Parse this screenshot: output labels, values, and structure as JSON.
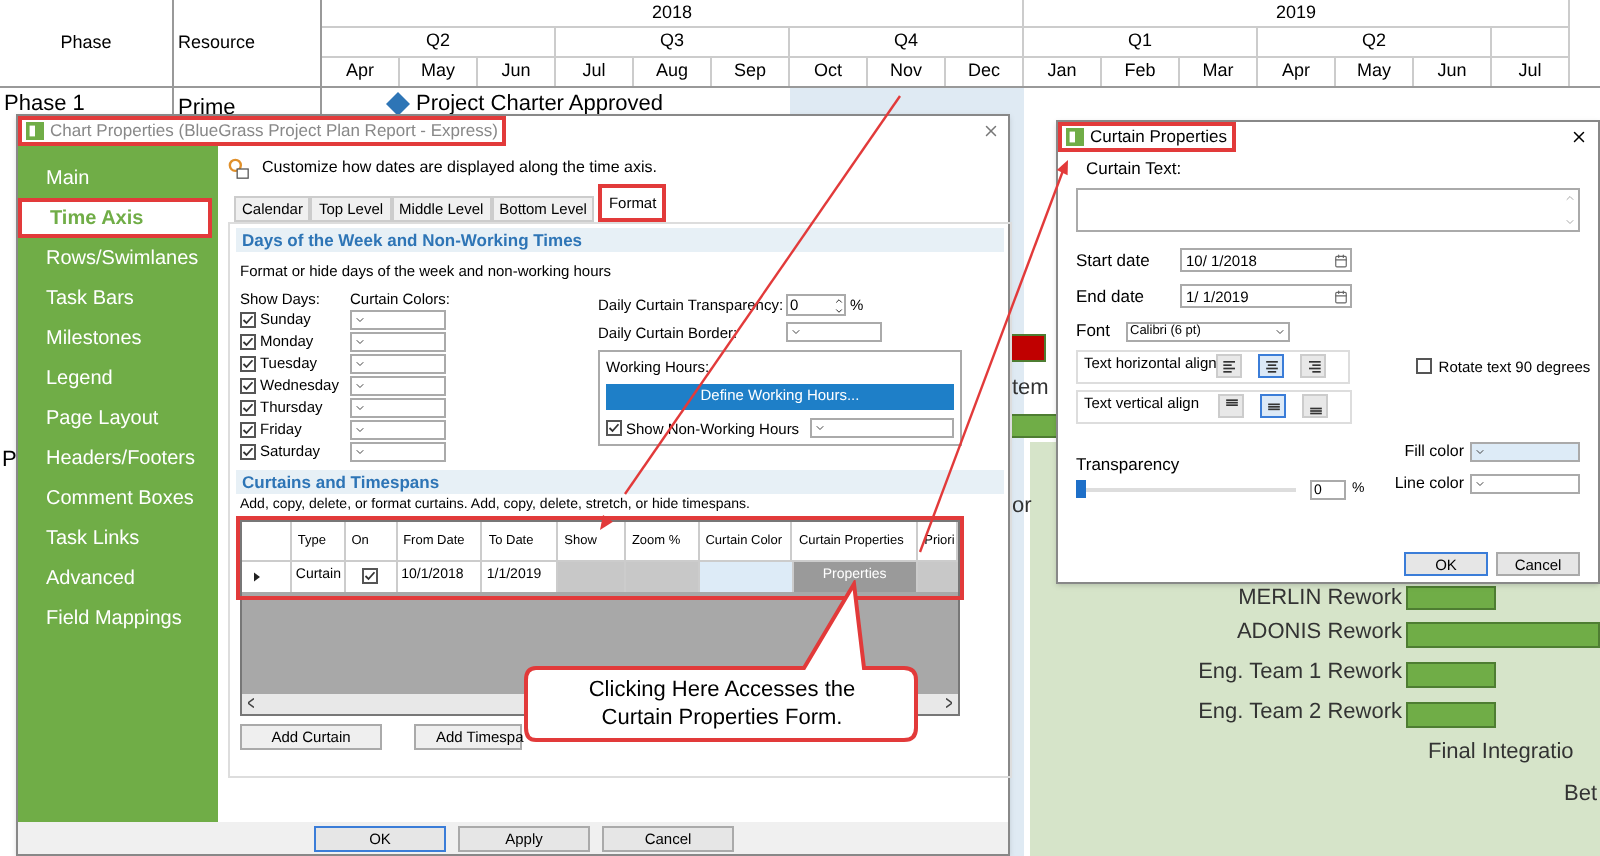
{
  "gantt": {
    "columns": [
      "Phase",
      "Resource"
    ],
    "years": [
      {
        "label": "2018",
        "quarters": [
          {
            "label": "Q2",
            "shaded": false,
            "months": [
              "Apr",
              "May",
              "Jun"
            ]
          },
          {
            "label": "Q3",
            "shaded": false,
            "months": [
              "Jul",
              "Aug",
              "Sep"
            ]
          },
          {
            "label": "Q4",
            "shaded": true,
            "months": [
              "Oct",
              "Nov",
              "Dec"
            ]
          }
        ]
      },
      {
        "label": "2019",
        "quarters": [
          {
            "label": "Q1",
            "shaded": false,
            "months": [
              "Jan",
              "Feb",
              "Mar"
            ]
          },
          {
            "label": "Q2",
            "shaded": false,
            "months": [
              "Apr",
              "May",
              "Jun"
            ]
          },
          {
            "shaded": false,
            "months": [
              "Jul"
            ]
          }
        ]
      }
    ],
    "rows": [
      {
        "phase": "Phase 1",
        "resource": "Prime",
        "milestone": "Project Charter Approved"
      },
      {
        "phase": "P"
      }
    ],
    "tasks": [
      {
        "color": "#c00000"
      },
      {
        "label": "tem"
      },
      {
        "color": "#70ad47"
      },
      {
        "label": "or"
      },
      {
        "label": "MERLIN Rework",
        "color": "#70ad47"
      },
      {
        "label": "ADONIS Rework",
        "color": "#70ad47"
      },
      {
        "label": "Eng. Team 1 Rework",
        "color": "#70ad47"
      },
      {
        "label": "Eng. Team 2 Rework",
        "color": "#70ad47"
      },
      {
        "label": "Final Integratio"
      },
      {
        "label": "Bet"
      }
    ]
  },
  "chart_properties": {
    "title": "Chart Properties (BlueGrass Project Plan Report - Express)",
    "sidebar": [
      {
        "label": "Main",
        "selected": false
      },
      {
        "label": "Time Axis",
        "selected": true
      },
      {
        "label": "Rows/Swimlanes",
        "selected": false
      },
      {
        "label": "Task Bars",
        "selected": false
      },
      {
        "label": "Milestones",
        "selected": false
      },
      {
        "label": "Legend",
        "selected": false
      },
      {
        "label": "Page Layout",
        "selected": false
      },
      {
        "label": "Headers/Footers",
        "selected": false
      },
      {
        "label": "Comment Boxes",
        "selected": false
      },
      {
        "label": "Task Links",
        "selected": false
      },
      {
        "label": "Advanced",
        "selected": false
      },
      {
        "label": "Field Mappings",
        "selected": false
      }
    ],
    "description": "Customize how dates are displayed along the time axis.",
    "tabs": [
      {
        "label": "Calendar",
        "selected": false
      },
      {
        "label": "Top Level",
        "selected": false
      },
      {
        "label": "Middle Level",
        "selected": false
      },
      {
        "label": "Bottom Level",
        "selected": false
      },
      {
        "label": "Format",
        "selected": true
      }
    ],
    "days_section": {
      "title": "Days of the Week and Non-Working Times",
      "description": "Format or hide days of the week and non-working hours",
      "show_days_label": "Show Days:",
      "curtain_colors_label": "Curtain Colors:",
      "days": [
        {
          "label": "Sunday",
          "checked": true
        },
        {
          "label": "Monday",
          "checked": true
        },
        {
          "label": "Tuesday",
          "checked": true
        },
        {
          "label": "Wednesday",
          "checked": true
        },
        {
          "label": "Thursday",
          "checked": true
        },
        {
          "label": "Friday",
          "checked": true
        },
        {
          "label": "Saturday",
          "checked": true
        }
      ],
      "transparency": {
        "label": "Daily Curtain Transparency:",
        "value": "0",
        "unit": "%"
      },
      "border": {
        "label": "Daily Curtain Border:"
      },
      "working_hours": {
        "label": "Working Hours:",
        "button": "Define Working Hours...",
        "show_non_working": {
          "label": "Show Non-Working Hours",
          "checked": true
        }
      }
    },
    "curtains_section": {
      "title": "Curtains and Timespans",
      "description": "Add, copy, delete, or format curtains. Add, copy, delete, stretch, or hide timespans.",
      "columns": [
        "Type",
        "On",
        "From Date",
        "To Date",
        "Show",
        "Zoom %",
        "Curtain Color",
        "Curtain Properties",
        "Priori"
      ],
      "rows": [
        {
          "type": "Curtain",
          "on": true,
          "from": "10/1/2018",
          "to": "1/1/2019",
          "color": "#ddebf7",
          "properties_button": "Properties"
        }
      ],
      "buttons": [
        "Add Curtain",
        "Add Timespa"
      ]
    },
    "footer_buttons": [
      "OK",
      "Apply",
      "Cancel"
    ]
  },
  "callout": {
    "text": "Clicking Here Accesses the Curtain Properties Form."
  },
  "curtain_properties": {
    "title": "Curtain Properties",
    "curtain_text_label": "Curtain Text:",
    "start_date": {
      "label": "Start date",
      "value": "10/ 1/2018"
    },
    "end_date": {
      "label": "End date",
      "value": "1/ 1/2019"
    },
    "font": {
      "label": "Font",
      "value": "Calibri (6 pt)"
    },
    "horizontal_align": {
      "label": "Text horizontal align",
      "options": [
        {
          "selected": false
        },
        {
          "selected": true
        },
        {
          "selected": false
        }
      ]
    },
    "vertical_align": {
      "label": "Text vertical align",
      "options": [
        {
          "selected": false
        },
        {
          "selected": true
        },
        {
          "selected": false
        }
      ]
    },
    "rotate": {
      "label": "Rotate text 90 degrees",
      "checked": false
    },
    "transparency": {
      "label": "Transparency",
      "level": 0,
      "value": "0",
      "unit": "%"
    },
    "colors": [
      {
        "label": "Fill color",
        "color": "#ddebf7"
      },
      {
        "label": "Line color",
        "color": "#ffffff"
      }
    ],
    "buttons": [
      "OK",
      "Cancel"
    ]
  }
}
